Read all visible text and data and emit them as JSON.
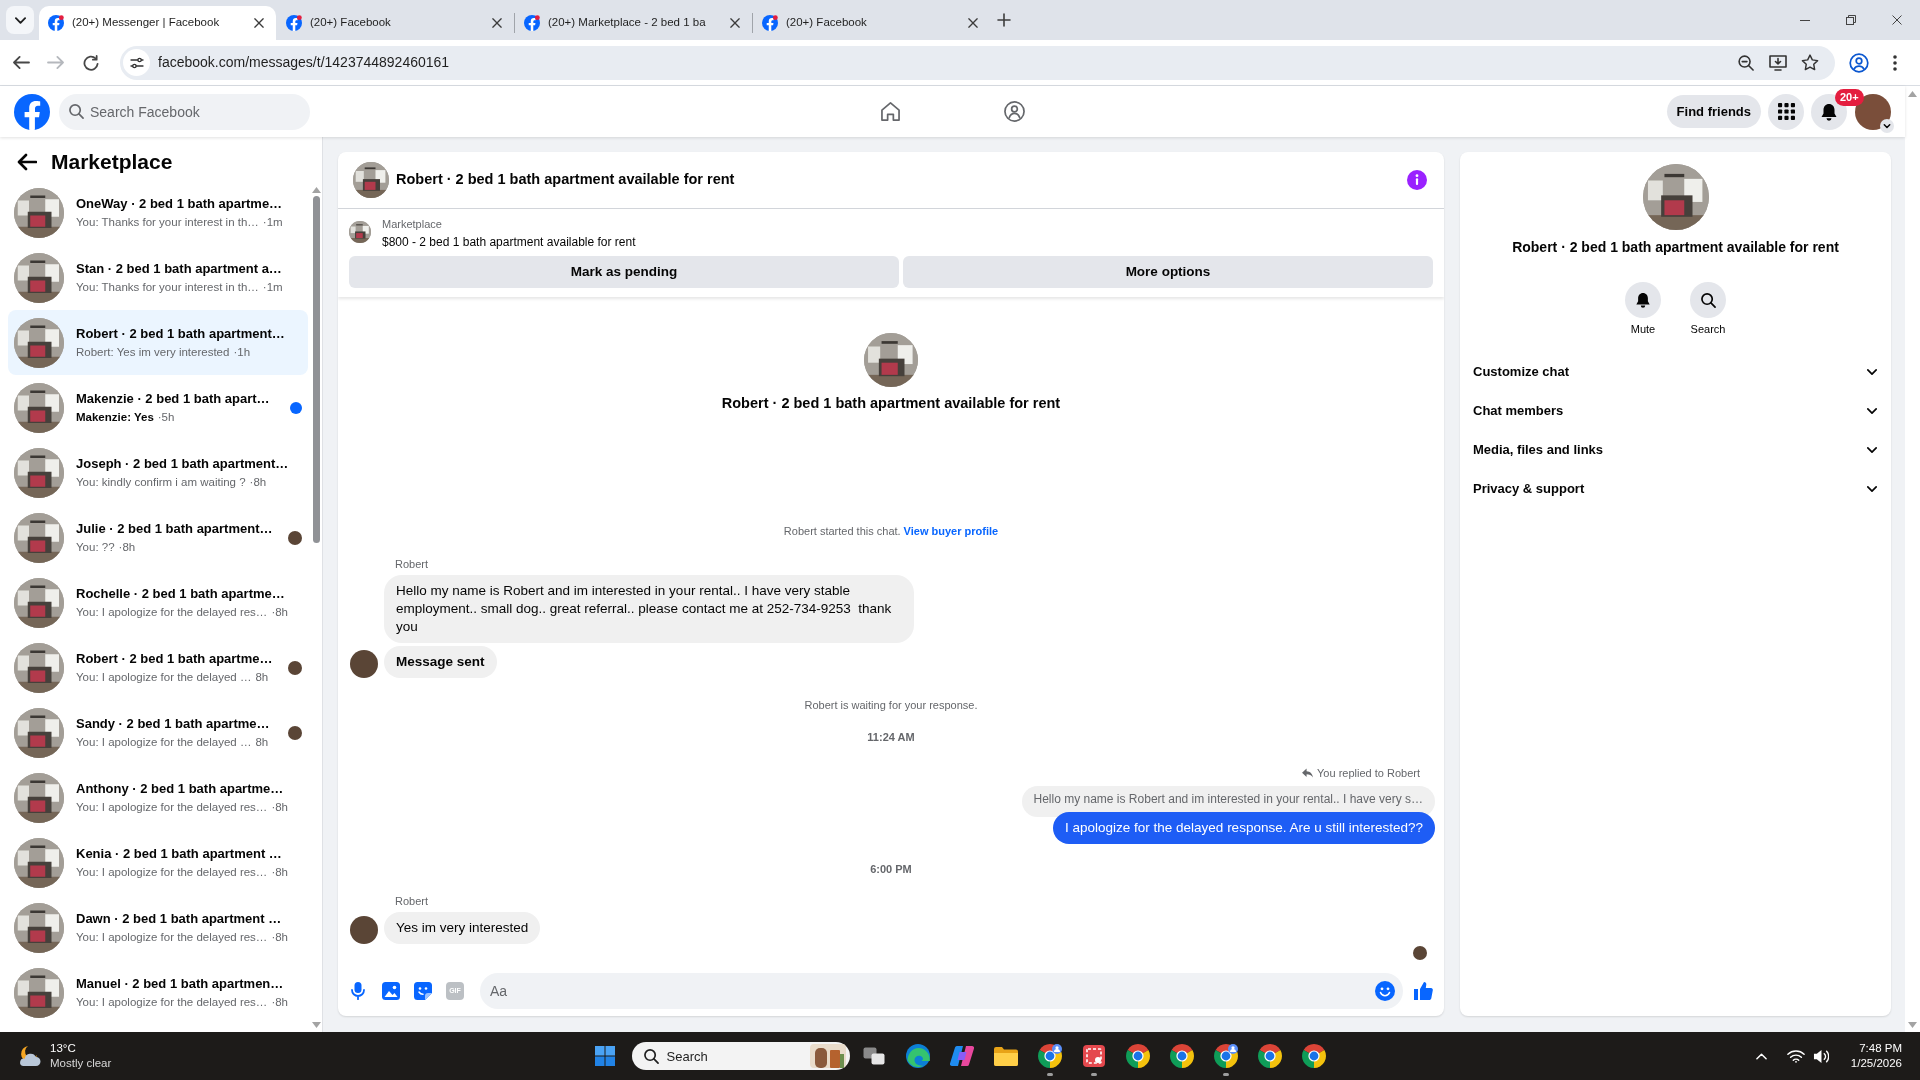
{
  "browser": {
    "tabs": [
      {
        "title": "(20+) Messenger | Facebook",
        "selected": true
      },
      {
        "title": "(20+) Facebook",
        "selected": false
      },
      {
        "title": "(20+) Marketplace - 2 bed 1 ba",
        "selected": false
      },
      {
        "title": "(20+) Facebook",
        "selected": false
      }
    ],
    "url": "facebook.com/messages/t/1423744892460161"
  },
  "header": {
    "search": {
      "placeholder": "Search Facebook"
    },
    "find_friends": "Find friends",
    "notification_badge": "20+"
  },
  "sidebar": {
    "title": "Marketplace",
    "conversations": [
      {
        "title": "OneWay · 2 bed 1 bath apartme…",
        "preview": "You: Thanks for your interest in th…",
        "time": "·1m",
        "selected": false,
        "unread": false,
        "seen": false
      },
      {
        "title": "Stan · 2 bed 1 bath apartment a…",
        "preview": "You: Thanks for your interest in th…",
        "time": "·1m",
        "selected": false,
        "unread": false,
        "seen": false
      },
      {
        "title": "Robert · 2 bed 1 bath apartment…",
        "preview": "Robert: Yes im very interested",
        "time": "·1h",
        "selected": true,
        "unread": false,
        "seen": false
      },
      {
        "title": "Makenzie · 2 bed 1 bath apart…",
        "preview": "Makenzie: Yes",
        "time": "·5h",
        "selected": false,
        "unread": true,
        "seen": false
      },
      {
        "title": "Joseph · 2 bed 1 bath apartment…",
        "preview": "You: kindly confirm i am waiting ?",
        "time": "·8h",
        "selected": false,
        "unread": false,
        "seen": false
      },
      {
        "title": "Julie · 2 bed 1 bath apartment…",
        "preview": "You: ??",
        "time": "·8h",
        "selected": false,
        "unread": false,
        "seen": true
      },
      {
        "title": "Rochelle · 2 bed 1 bath apartme…",
        "preview": "You: I apologize for the delayed res…",
        "time": "·8h",
        "selected": false,
        "unread": false,
        "seen": false
      },
      {
        "title": "Robert · 2 bed 1 bath apartme…",
        "preview": "You: I apologize for the delayed …",
        "time": "8h",
        "selected": false,
        "unread": false,
        "seen": true
      },
      {
        "title": "Sandy · 2 bed 1 bath apartme…",
        "preview": "You: I apologize for the delayed …",
        "time": "8h",
        "selected": false,
        "unread": false,
        "seen": true
      },
      {
        "title": "Anthony · 2 bed 1 bath apartme…",
        "preview": "You: I apologize for the delayed res…",
        "time": "·8h",
        "selected": false,
        "unread": false,
        "seen": false
      },
      {
        "title": "Kenia · 2 bed 1 bath apartment …",
        "preview": "You: I apologize for the delayed res…",
        "time": "·8h",
        "selected": false,
        "unread": false,
        "seen": false
      },
      {
        "title": "Dawn · 2 bed 1 bath apartment …",
        "preview": "You: I apologize for the delayed res…",
        "time": "·8h",
        "selected": false,
        "unread": false,
        "seen": false
      },
      {
        "title": "Manuel · 2 bed 1 bath apartmen…",
        "preview": "You: I apologize for the delayed res…",
        "time": "·8h",
        "selected": false,
        "unread": false,
        "seen": false
      }
    ]
  },
  "chat": {
    "title": "Robert · 2 bed 1 bath apartment available for rent",
    "listing": {
      "label": "Marketplace",
      "text": "$800 - 2 bed 1 bath apartment available for rent"
    },
    "actions": [
      "Mark as pending",
      "More options"
    ],
    "intro_title": "Robert · 2 bed 1 bath apartment available for rent",
    "messages": [
      {
        "kind": "started",
        "text": "Robert started this chat.",
        "link": "View buyer profile"
      },
      {
        "kind": "sender",
        "text": "Robert"
      },
      {
        "kind": "incoming",
        "text": "Hello my name is Robert and im interested in your rental.. I have very stable employment.. small dog.. great referral.. please contact me at 252-734-9253  thank you",
        "bold": false,
        "avatar": false
      },
      {
        "kind": "incoming",
        "text": "Message sent",
        "bold": true,
        "avatar": true
      },
      {
        "kind": "system",
        "text": "Robert is waiting for your response."
      },
      {
        "kind": "timestamp",
        "text": "11:24 AM"
      },
      {
        "kind": "reply_note",
        "text": "You replied to Robert"
      },
      {
        "kind": "quoted",
        "text": "Hello my name is Robert and im interested in your rental.. I have very s…"
      },
      {
        "kind": "outgoing",
        "text": "I apologize for the delayed response. Are u still interested??"
      },
      {
        "kind": "timestamp",
        "text": "6:00 PM"
      },
      {
        "kind": "sender",
        "text": "Robert"
      },
      {
        "kind": "incoming",
        "text": "Yes im very interested",
        "bold": false,
        "avatar": true
      },
      {
        "kind": "seen"
      }
    ],
    "composer": {
      "gif": "GIF",
      "placeholder": "Aa"
    }
  },
  "details": {
    "title": "Robert · 2 bed 1 bath apartment available for rent",
    "actions": [
      {
        "kind": "mute",
        "label": "Mute"
      },
      {
        "kind": "search",
        "label": "Search"
      }
    ],
    "sections": [
      {
        "label": "Customize chat",
        "expanded": false
      },
      {
        "label": "Chat members",
        "expanded": false
      },
      {
        "label": "Media, files and links",
        "expanded": false
      },
      {
        "label": "Privacy & support",
        "expanded": false
      }
    ]
  },
  "taskbar": {
    "weather": {
      "temperature": "13°C",
      "condition": "Mostly clear"
    },
    "search": {
      "placeholder": "Search"
    },
    "apps": [
      {
        "kind": "task_view",
        "open": false
      },
      {
        "kind": "edge",
        "open": false
      },
      {
        "kind": "copilot",
        "open": false
      },
      {
        "kind": "explorer",
        "open": false
      },
      {
        "kind": "chrome_profile",
        "open": true
      },
      {
        "kind": "snipping_tool",
        "open": true
      },
      {
        "kind": "chrome",
        "open": false
      },
      {
        "kind": "chrome",
        "open": false
      },
      {
        "kind": "chrome_profile",
        "open": true
      },
      {
        "kind": "chrome",
        "open": false
      },
      {
        "kind": "chrome",
        "open": false
      }
    ],
    "clock": {
      "time": "7:48 PM",
      "date": "1/25/2026"
    }
  }
}
